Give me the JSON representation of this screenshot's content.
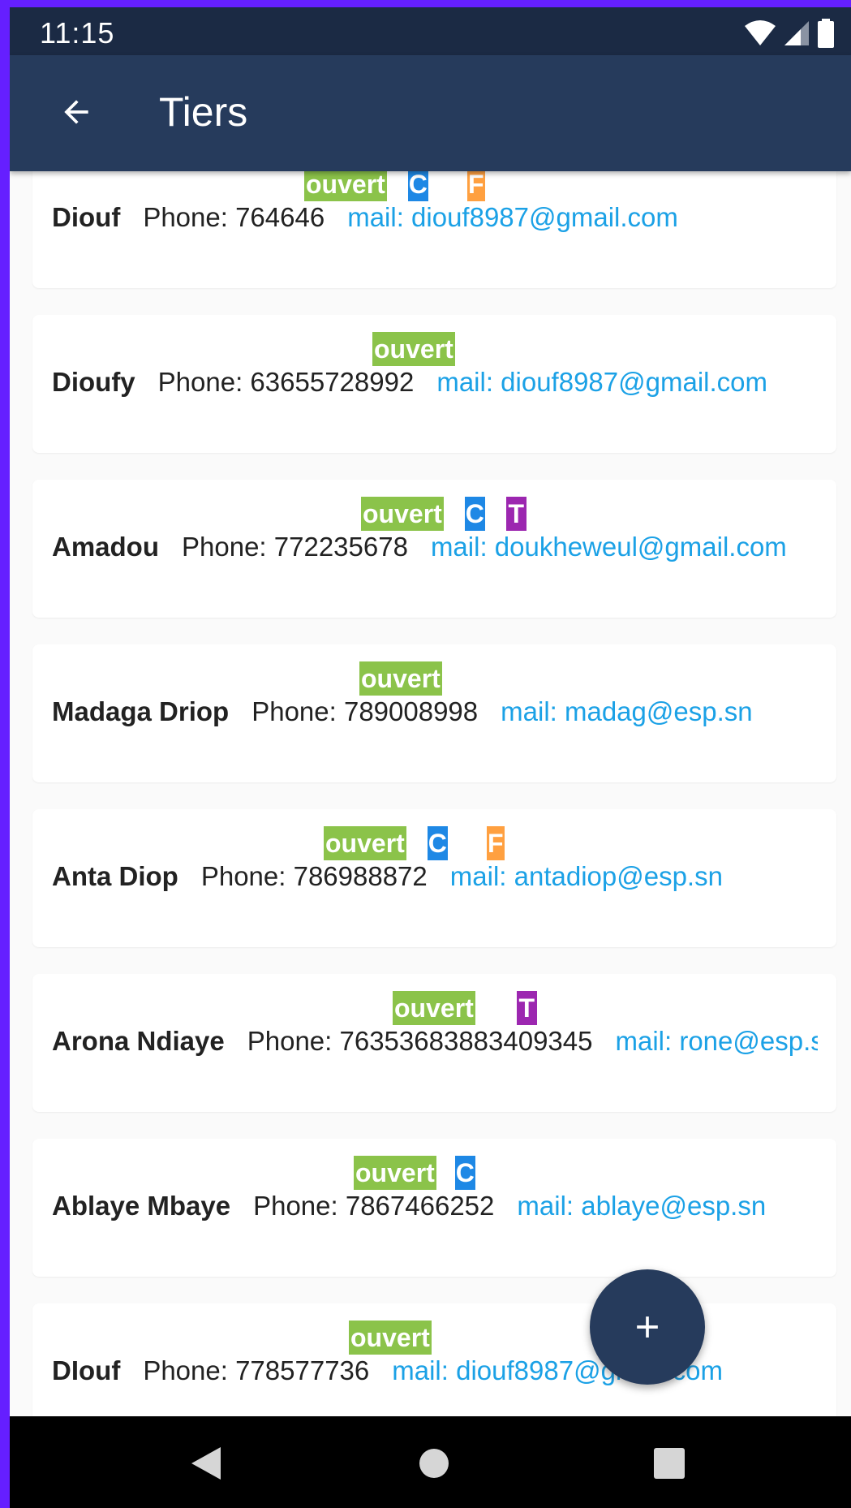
{
  "status_bar": {
    "time": "11:15",
    "icons": [
      "wifi-icon",
      "signal-icon",
      "battery-icon"
    ]
  },
  "app_bar": {
    "title": "Tiers",
    "back_icon": "arrow-back-icon"
  },
  "list": {
    "items": [
      {
        "name": "Diouf",
        "phone": "Phone: 764646",
        "mail": "mail: diouf8987@gmail.com",
        "status": "ouvert",
        "tags": [
          "C",
          "F"
        ]
      },
      {
        "name": "Dioufy",
        "phone": "Phone: 63655728992",
        "mail": "mail: diouf8987@gmail.com",
        "status": "ouvert",
        "tags": []
      },
      {
        "name": "Amadou",
        "phone": "Phone: 772235678",
        "mail": "mail: doukheweul@gmail.com",
        "status": "ouvert",
        "tags": [
          "C",
          "T"
        ]
      },
      {
        "name": "Madaga Driop",
        "phone": "Phone: 789008998",
        "mail": "mail: madag@esp.sn",
        "status": "ouvert",
        "tags": []
      },
      {
        "name": "Anta Diop",
        "phone": "Phone: 786988872",
        "mail": "mail: antadiop@esp.sn",
        "status": "ouvert",
        "tags": [
          "C",
          "F"
        ]
      },
      {
        "name": "Arona Ndiaye",
        "phone": "Phone: 76353683883409345",
        "mail": "mail: rone@esp.sn",
        "status": "ouvert",
        "tags": [
          "T"
        ]
      },
      {
        "name": "Ablaye Mbaye",
        "phone": "Phone: 7867466252",
        "mail": "mail: ablaye@esp.sn",
        "status": "ouvert",
        "tags": [
          "C"
        ]
      },
      {
        "name": "DIouf",
        "phone": "Phone: 778577736",
        "mail": "mail: diouf8987@gmail.com",
        "status": "ouvert",
        "tags": []
      }
    ]
  },
  "fab": {
    "icon": "add-icon"
  },
  "nav_bar": {
    "icons": [
      "nav-back-icon",
      "nav-home-icon",
      "nav-recents-icon"
    ]
  },
  "colors": {
    "status_bar": "#1b2a44",
    "app_bar": "#263b5c",
    "badge_open": "#8bc34a",
    "badge_c": "#1e88e5",
    "badge_f": "#ffa040",
    "badge_t": "#9c27b0",
    "mail": "#1ba1e6"
  }
}
